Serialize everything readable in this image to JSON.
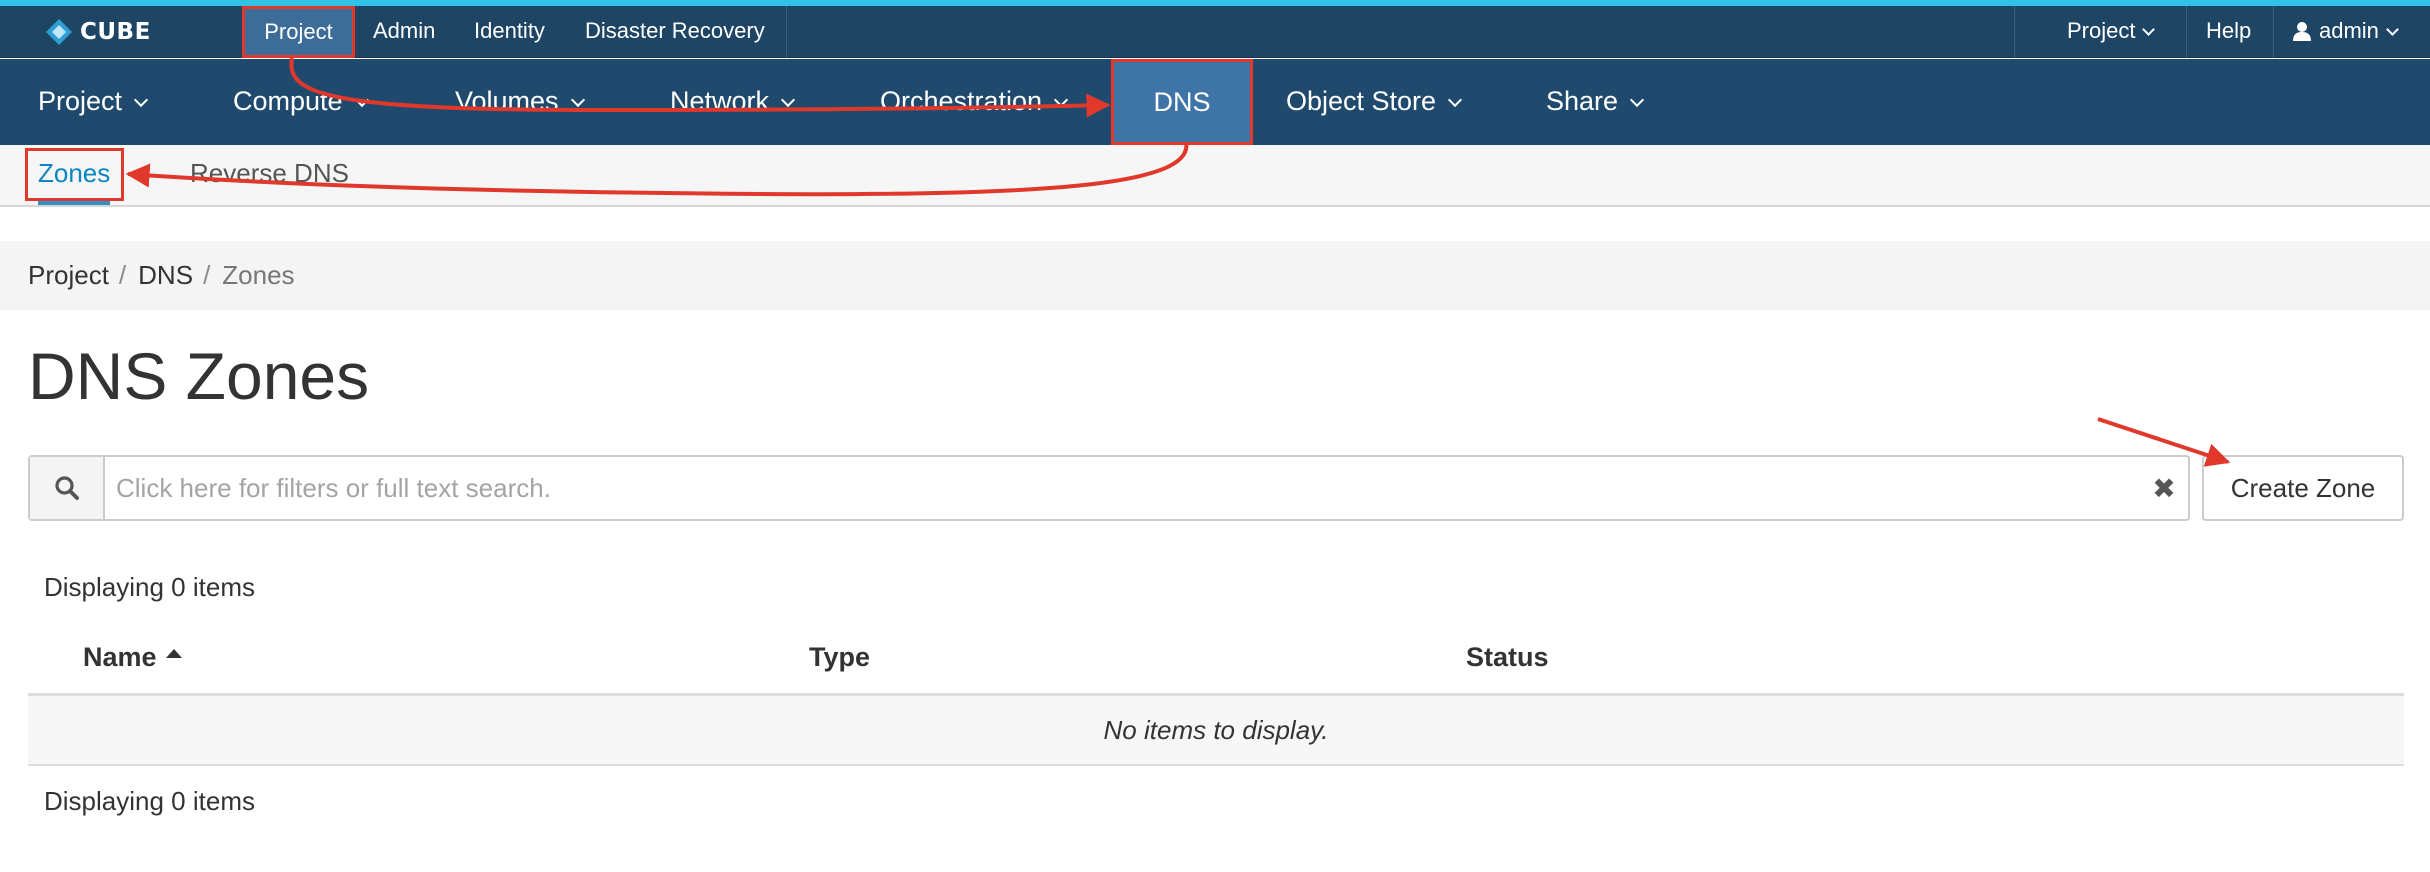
{
  "topbar": {
    "logo": "CUBE",
    "items": [
      {
        "label": "Project",
        "active": true
      },
      {
        "label": "Admin"
      },
      {
        "label": "Identity"
      },
      {
        "label": "Disaster Recovery"
      }
    ],
    "right": {
      "project_menu": "Project",
      "help": "Help",
      "user": "admin"
    }
  },
  "mainnav": {
    "items": [
      {
        "label": "Project"
      },
      {
        "label": "Compute"
      },
      {
        "label": "Volumes"
      },
      {
        "label": "Network"
      },
      {
        "label": "Orchestration"
      },
      {
        "label": "DNS",
        "active": true
      },
      {
        "label": "Object Store"
      },
      {
        "label": "Share"
      }
    ]
  },
  "subnav": {
    "items": [
      {
        "label": "Zones",
        "active": true
      },
      {
        "label": "Reverse DNS"
      }
    ]
  },
  "breadcrumb": [
    "Project",
    "DNS",
    "Zones"
  ],
  "page_title": "DNS Zones",
  "search": {
    "placeholder": "Click here for filters or full text search.",
    "value": ""
  },
  "create_button": "Create Zone",
  "table": {
    "count_top": "Displaying 0 items",
    "count_bottom": "Displaying 0 items",
    "columns": [
      "Name",
      "Type",
      "Status"
    ],
    "empty_message": "No items to display."
  },
  "colors": {
    "topbar": "#1f4565",
    "mainnav": "#204a6d",
    "active_nav": "#3f74a6",
    "accent_line": "#31c2e6",
    "annotation": "#e1382c",
    "link": "#0b86c1"
  }
}
